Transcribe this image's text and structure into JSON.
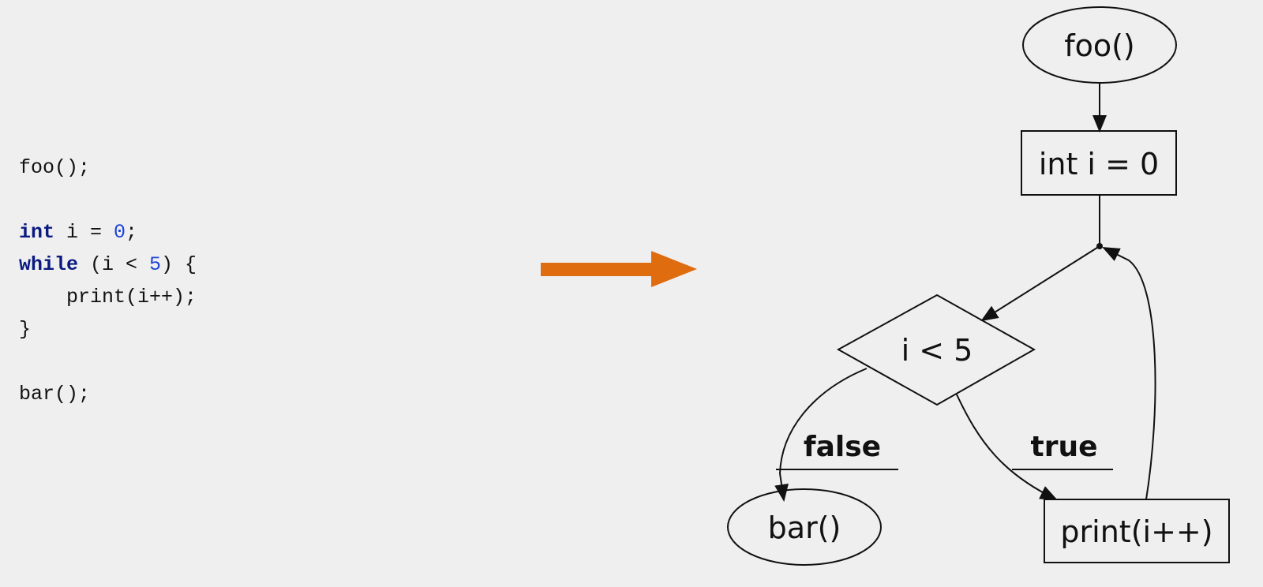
{
  "code": {
    "lines": [
      {
        "parts": [
          {
            "t": "foo();",
            "c": "plain"
          }
        ]
      },
      {
        "parts": []
      },
      {
        "parts": [
          {
            "t": "int",
            "c": "kw"
          },
          {
            "t": " i = ",
            "c": "plain"
          },
          {
            "t": "0",
            "c": "num"
          },
          {
            "t": ";",
            "c": "plain"
          }
        ]
      },
      {
        "parts": [
          {
            "t": "while",
            "c": "kw"
          },
          {
            "t": " (i < ",
            "c": "plain"
          },
          {
            "t": "5",
            "c": "num"
          },
          {
            "t": ") {",
            "c": "plain"
          }
        ]
      },
      {
        "parts": [
          {
            "t": "    print(i++);",
            "c": "plain"
          }
        ]
      },
      {
        "parts": [
          {
            "t": "}",
            "c": "plain"
          }
        ]
      },
      {
        "parts": []
      },
      {
        "parts": [
          {
            "t": "bar();",
            "c": "plain"
          }
        ]
      }
    ],
    "colors": {
      "keyword": "#0a1a80",
      "number": "#1f45d6",
      "text": "#111111"
    }
  },
  "transform_arrow": {
    "color": "#e06c10",
    "icon": "right-arrow"
  },
  "flowchart": {
    "nodes": {
      "foo": {
        "label": "foo()",
        "shape": "ellipse"
      },
      "init": {
        "label": "int i = 0",
        "shape": "box"
      },
      "cond": {
        "label": "i < 5",
        "shape": "diamond"
      },
      "bar": {
        "label": "bar()",
        "shape": "ellipse"
      },
      "print": {
        "label": "print(i++)",
        "shape": "box"
      }
    },
    "edges": [
      {
        "from": "foo",
        "to": "init"
      },
      {
        "from": "init",
        "to": "join"
      },
      {
        "from": "join",
        "to": "cond"
      },
      {
        "from": "cond",
        "to": "bar",
        "label": "false"
      },
      {
        "from": "cond",
        "to": "print",
        "label": "true"
      },
      {
        "from": "print",
        "to": "join"
      }
    ],
    "edge_labels": {
      "false": "false",
      "true": "true"
    }
  }
}
